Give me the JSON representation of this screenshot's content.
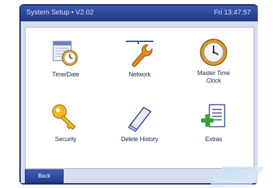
{
  "window": {
    "title": "System Setup • V2.02",
    "clock": "Fri 13:47:57"
  },
  "menu": {
    "items": [
      {
        "label": "Time/Date",
        "icon": "calendar-clock-icon"
      },
      {
        "label": "Network",
        "icon": "wrench-icon"
      },
      {
        "label": "Master Time Clock",
        "icon": "wall-clock-icon"
      },
      {
        "label": "Security",
        "icon": "key-icon"
      },
      {
        "label": "Delete History",
        "icon": "eraser-icon"
      },
      {
        "label": "Extras",
        "icon": "document-add-icon"
      }
    ]
  },
  "footer": {
    "back_label": "Back"
  },
  "colors": {
    "titlebar": "#2a4496",
    "screen_background": "#d7dcef",
    "panel": "#ffffff",
    "label_text": "#1f2b55"
  }
}
